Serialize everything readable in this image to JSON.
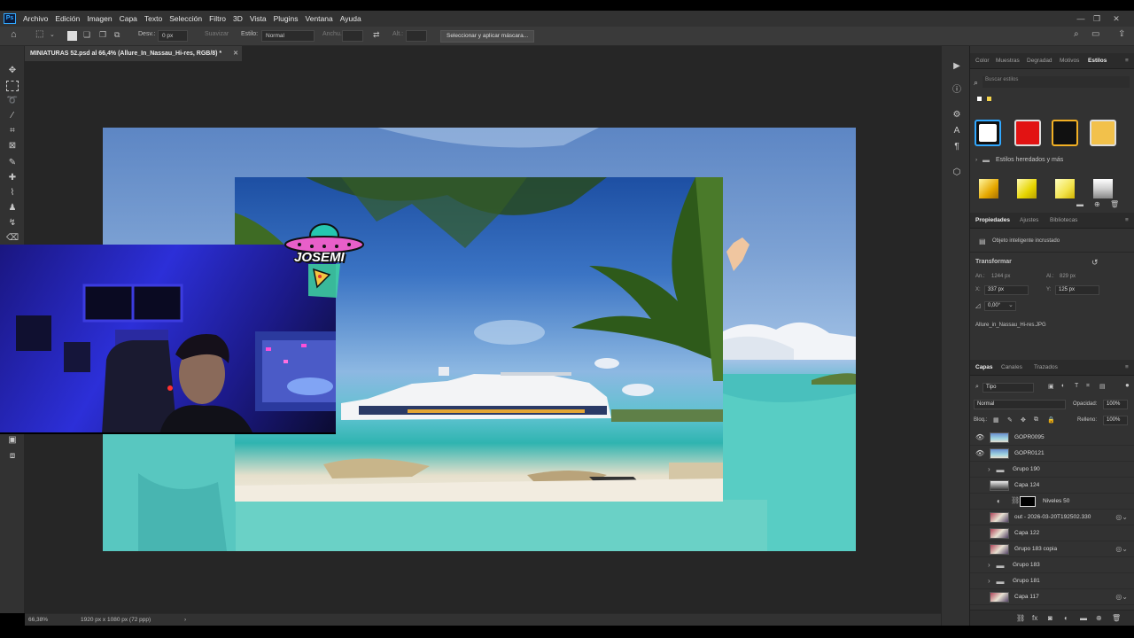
{
  "app": {
    "logo": "Ps"
  },
  "menu": [
    "Archivo",
    "Edición",
    "Imagen",
    "Capa",
    "Texto",
    "Selección",
    "Filtro",
    "3D",
    "Vista",
    "Plugins",
    "Ventana",
    "Ayuda"
  ],
  "options": {
    "desvan_label": "Desv.:",
    "desvan_value": "0 px",
    "suavizar": "Suavizar",
    "estilo_label": "Estilo:",
    "estilo_value": "Normal",
    "anchura": "Anchu.:",
    "altura": "Alt.:",
    "mask_button": "Seleccionar y aplicar máscara..."
  },
  "document": {
    "tab_title": "MINIATURAS 52.psd al 66,4% (Allure_In_Nassau_Hi-res, RGB/8) *"
  },
  "overlay": {
    "logo_text": "JOSEMI"
  },
  "status": {
    "zoom": "66,38%",
    "doc_info": "1920 px x 1080 px (72 ppp)",
    "arrow": "›"
  },
  "styles_panel": {
    "tabs": [
      "Color",
      "Muestras",
      "Degradad",
      "Motivos",
      "Estilos"
    ],
    "active_tab": "Estilos",
    "search_placeholder": "Buscar estilos",
    "inherited_label": "Estilos heredados y más",
    "swatch_colors": [
      "#ffffff",
      "#e21313",
      "#111111",
      "#f2c14b"
    ]
  },
  "properties_panel": {
    "tabs": [
      "Propiedades",
      "Ajustes",
      "Bibliotecas"
    ],
    "active_tab": "Propiedades",
    "type_label": "Objeto inteligente incrustado",
    "section": "Transformar",
    "width_label": "An.:",
    "width_value": "1244 px",
    "height_label": "Al.:",
    "height_value": "829 px",
    "x_label": "X:",
    "x_value": "337 px",
    "y_label": "Y:",
    "y_value": "125 px",
    "angle_value": "0,00°",
    "file_name": "Allure_in_Nassau_Hi-res.JPG"
  },
  "layers_panel": {
    "tabs": [
      "Capas",
      "Canales",
      "Trazados"
    ],
    "active_tab": "Capas",
    "filter_label": "Tipo",
    "blend_mode": "Normal",
    "opacity_label": "Opacidad:",
    "opacity_value": "100%",
    "lock_label": "Bloq.:",
    "fill_label": "Relleno:",
    "fill_value": "100%",
    "layers": [
      {
        "name": "GOPR0095",
        "visible": true,
        "kind": "layer"
      },
      {
        "name": "GOPR0121",
        "visible": true,
        "kind": "layer"
      },
      {
        "name": "Grupo 190",
        "visible": false,
        "kind": "group"
      },
      {
        "name": "Capa 124",
        "visible": false,
        "kind": "layer"
      },
      {
        "name": "Niveles 50",
        "visible": false,
        "kind": "adjustment"
      },
      {
        "name": "out - 2026-03-20T192502.330",
        "visible": false,
        "kind": "layer"
      },
      {
        "name": "Capa 122",
        "visible": false,
        "kind": "layer"
      },
      {
        "name": "Grupo 183 copia",
        "visible": false,
        "kind": "layer"
      },
      {
        "name": "Grupo 183",
        "visible": false,
        "kind": "group"
      },
      {
        "name": "Grupo 181",
        "visible": false,
        "kind": "group"
      },
      {
        "name": "Capa 117",
        "visible": false,
        "kind": "layer"
      }
    ]
  }
}
